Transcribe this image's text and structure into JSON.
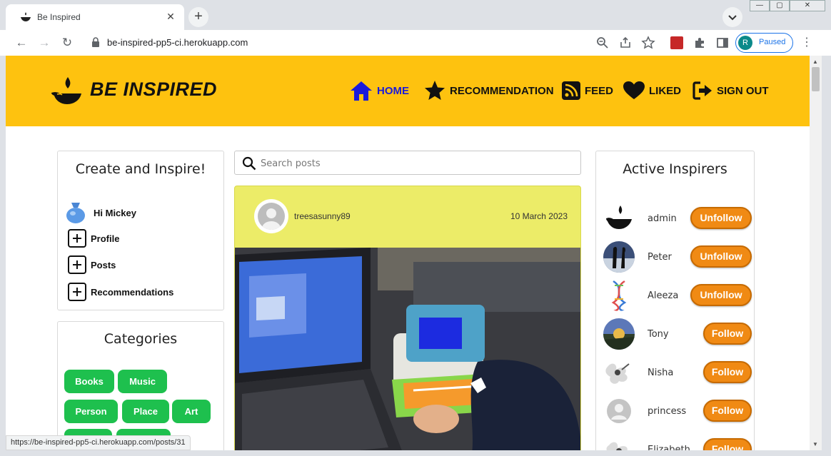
{
  "browser": {
    "tab_title": "Be Inspired",
    "tab_close": "✕",
    "new_tab": "+",
    "url": "be-inspired-pp5-ci.herokuapp.com",
    "profile_initial": "R",
    "profile_status": "Paused",
    "status_url": "https://be-inspired-pp5-ci.herokuapp.com/posts/31",
    "window_controls": [
      "—",
      "▢",
      "✕"
    ]
  },
  "site": {
    "brand": "BE INSPIRED",
    "nav": [
      {
        "label": "HOME",
        "icon": "home-icon",
        "active": true
      },
      {
        "label": "RECOMMENDATION",
        "icon": "star-icon"
      },
      {
        "label": "FEED",
        "icon": "rss-icon"
      },
      {
        "label": "LIKED",
        "icon": "heart-icon"
      },
      {
        "label": "SIGN OUT",
        "icon": "sign-out-icon"
      }
    ],
    "accent_color": "#fec20f"
  },
  "left_panel": {
    "title": "Create and Inspire!",
    "greeting": "Hi Mickey",
    "links": [
      "Profile",
      "Posts",
      "Recommendations"
    ]
  },
  "categories": {
    "title": "Categories",
    "items": [
      "Books",
      "Music",
      "Person",
      "Place",
      "Art"
    ]
  },
  "search": {
    "placeholder": "Search posts"
  },
  "post": {
    "author": "treesasunny89",
    "date": "10 March 2023"
  },
  "inspirers": {
    "title": "Active Inspirers",
    "items": [
      {
        "name": "admin",
        "action": "Unfollow"
      },
      {
        "name": "Peter",
        "action": "Unfollow"
      },
      {
        "name": "Aleeza",
        "action": "Unfollow"
      },
      {
        "name": "Tony",
        "action": "Follow"
      },
      {
        "name": "Nisha",
        "action": "Follow"
      },
      {
        "name": "princess",
        "action": "Follow"
      },
      {
        "name": "Elizabeth",
        "action": "Follow"
      }
    ]
  }
}
